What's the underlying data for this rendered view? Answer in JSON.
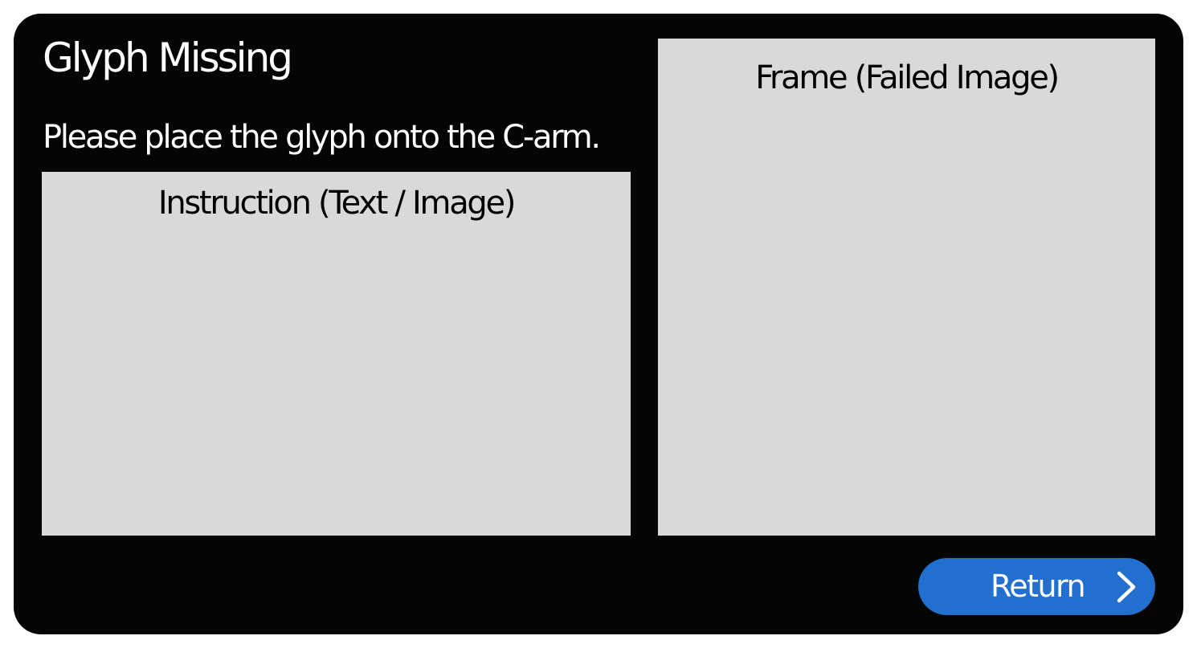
{
  "dialog": {
    "title": "Glyph Missing",
    "message": "Please place the glyph onto the C-arm."
  },
  "instruction_panel": {
    "label": "Instruction (Text / Image)"
  },
  "frame_panel": {
    "label": "Frame (Failed Image)"
  },
  "return_button": {
    "label": "Return",
    "icon": "chevron-right-icon"
  },
  "colors": {
    "dialog_background": "#050505",
    "panel_background": "#d9d9d9",
    "button_background": "#226fcf",
    "text_light": "#ffffff",
    "text_dark": "#000000"
  }
}
